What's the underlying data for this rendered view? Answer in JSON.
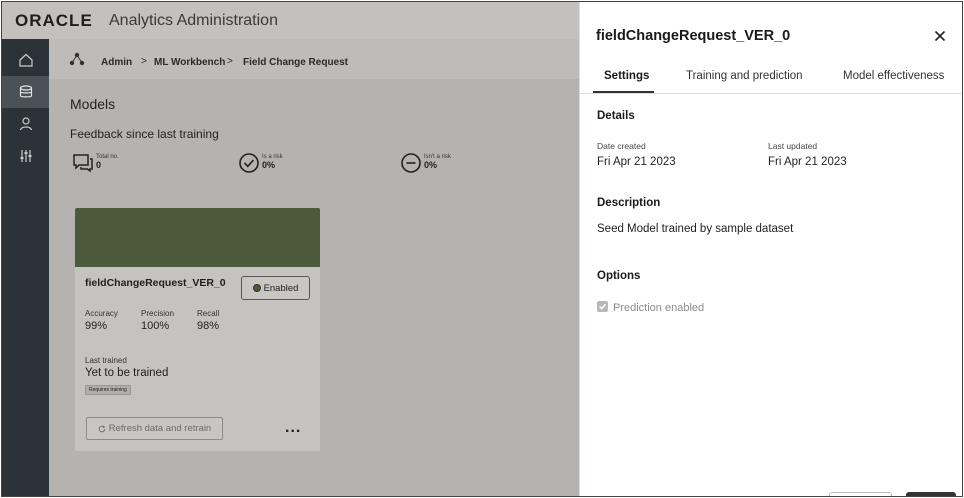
{
  "header": {
    "logo": "ORACLE",
    "app_title": "Analytics Administration"
  },
  "rail": {
    "items": [
      {
        "icon": "home-icon"
      },
      {
        "icon": "database-icon",
        "active": true
      },
      {
        "icon": "user-icon"
      },
      {
        "icon": "sliders-icon"
      }
    ]
  },
  "breadcrumb": {
    "icon": "network-icon",
    "items": [
      "Admin",
      "ML Workbench",
      "Field Change Request"
    ],
    "separator": ">"
  },
  "main": {
    "title": "Models",
    "feedback_title": "Feedback since last training",
    "metrics": [
      {
        "icon": "chat-icon",
        "label": "Total no.",
        "value": "0"
      },
      {
        "icon": "check-circle-icon",
        "label": "Is a risk",
        "value": "0%"
      },
      {
        "icon": "minus-circle-icon",
        "label": "Isn't a risk",
        "value": "0%"
      }
    ]
  },
  "card": {
    "banner_color": "#4c5a3c",
    "name": "fieldChangeRequest_VER_0",
    "status_label": "Enabled",
    "stats": [
      {
        "label": "Accuracy",
        "value": "99%"
      },
      {
        "label": "Precision",
        "value": "100%"
      },
      {
        "label": "Recall",
        "value": "98%"
      }
    ],
    "last_trained_label": "Last trained",
    "last_trained_value": "Yet to be trained",
    "tag": "Requires training",
    "retrain_label": "Refresh data and retrain",
    "more_label": "..."
  },
  "panel": {
    "title": "fieldChangeRequest_VER_0",
    "tabs": [
      {
        "label": "Settings",
        "active": true
      },
      {
        "label": "Training and prediction"
      },
      {
        "label": "Model effectiveness"
      }
    ],
    "details_title": "Details",
    "date_created_label": "Date created",
    "date_created_value": "Fri Apr 21 2023",
    "last_updated_label": "Last updated",
    "last_updated_value": "Fri Apr 21 2023",
    "description_title": "Description",
    "description_value": "Seed Model trained by sample dataset",
    "options_title": "Options",
    "prediction_enabled_label": "Prediction enabled",
    "prediction_enabled": true
  }
}
